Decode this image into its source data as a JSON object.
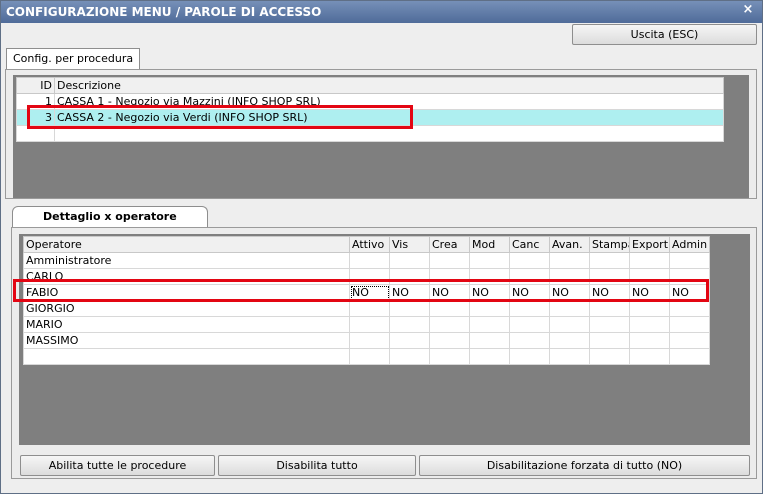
{
  "window": {
    "title": "CONFIGURAZIONE MENU / PAROLE DI ACCESSO",
    "close_glyph": "×"
  },
  "toolbar": {
    "exit_label": "Uscita (ESC)"
  },
  "tab_procedure": {
    "label": "Config. per procedura"
  },
  "procedures": {
    "columns": [
      "ID",
      "Descrizione"
    ],
    "rows": [
      {
        "id": "1",
        "description": "CASSA 1 - Negozio via Mazzini (INFO SHOP SRL)"
      },
      {
        "id": "3",
        "description": "CASSA 2 - Negozio via Verdi (INFO SHOP SRL)"
      }
    ],
    "selected_id": "3"
  },
  "tab_operators": {
    "label": "Dettaglio x operatore"
  },
  "operators": {
    "columns": [
      "Operatore",
      "Attivo",
      "Vis",
      "Crea",
      "Mod",
      "Canc",
      "Avan.",
      "Stampa",
      "Export",
      "Admin"
    ],
    "rows": [
      {
        "name": "Amministratore",
        "values": [
          "",
          "",
          "",
          "",
          "",
          "",
          "",
          "",
          ""
        ]
      },
      {
        "name": "CARLO",
        "values": [
          "",
          "",
          "",
          "",
          "",
          "",
          "",
          "",
          ""
        ]
      },
      {
        "name": "FABIO",
        "values": [
          "NO",
          "NO",
          "NO",
          "NO",
          "NO",
          "NO",
          "NO",
          "NO",
          "NO"
        ]
      },
      {
        "name": "GIORGIO",
        "values": [
          "",
          "",
          "",
          "",
          "",
          "",
          "",
          "",
          ""
        ]
      },
      {
        "name": "MARIO",
        "values": [
          "",
          "",
          "",
          "",
          "",
          "",
          "",
          "",
          ""
        ]
      },
      {
        "name": "MASSIMO",
        "values": [
          "",
          "",
          "",
          "",
          "",
          "",
          "",
          "",
          ""
        ]
      }
    ]
  },
  "footer": {
    "enable_all_label": "Abilita tutte le procedure",
    "disable_all_label": "Disabilita tutto",
    "force_disable_label": "Disabilitazione forzata di tutto (NO)"
  },
  "colors": {
    "title_bar": "#4f6b99",
    "selected_row": "#aeeff0",
    "highlight_border": "#e30613"
  }
}
